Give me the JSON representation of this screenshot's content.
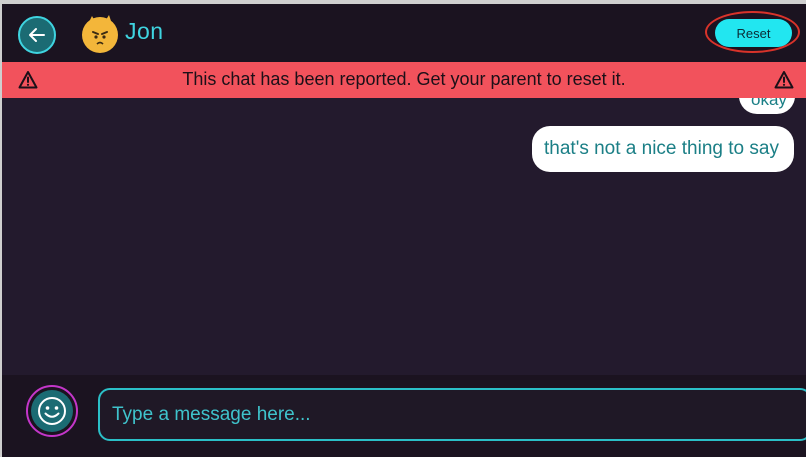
{
  "header": {
    "contact_name": "Jon",
    "reset_label": "Reset",
    "back_icon": "arrow-left-icon",
    "avatar_icon": "cat-avatar-icon"
  },
  "banner": {
    "text": "This chat has been reported. Get your parent to reset it.",
    "icon": "warning-triangle-icon"
  },
  "messages": [
    {
      "text": "okay"
    },
    {
      "text": "that's not a nice thing to say"
    }
  ],
  "composer": {
    "placeholder": "Type a message here...",
    "emoji_icon": "smiley-icon"
  },
  "colors": {
    "accent": "#22e6f0",
    "banner": "#f2525c",
    "background": "#231a2d",
    "header": "#1b1320",
    "highlight_ring": "#d9332a"
  }
}
